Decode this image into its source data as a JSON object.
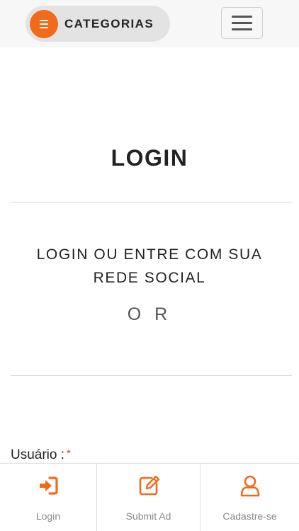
{
  "header": {
    "categories_label": "CATEGORIAS",
    "categories_icon": "menu-list-icon",
    "menu_icon": "hamburger-menu-icon"
  },
  "page": {
    "title": "LOGIN",
    "social_text": "LOGIN OU ENTRE COM SUA REDE SOCIAL",
    "or_text": "O R"
  },
  "form": {
    "username_label": "Usuário :",
    "required_mark": "*"
  },
  "bottom_nav": {
    "items": [
      {
        "label": "Login",
        "icon": "sign-in-icon"
      },
      {
        "label": "Submit Ad",
        "icon": "edit-icon"
      },
      {
        "label": "Cadastre-se",
        "icon": "user-icon"
      }
    ]
  },
  "colors": {
    "accent": "#f26a1b",
    "required": "#e03a2f"
  }
}
